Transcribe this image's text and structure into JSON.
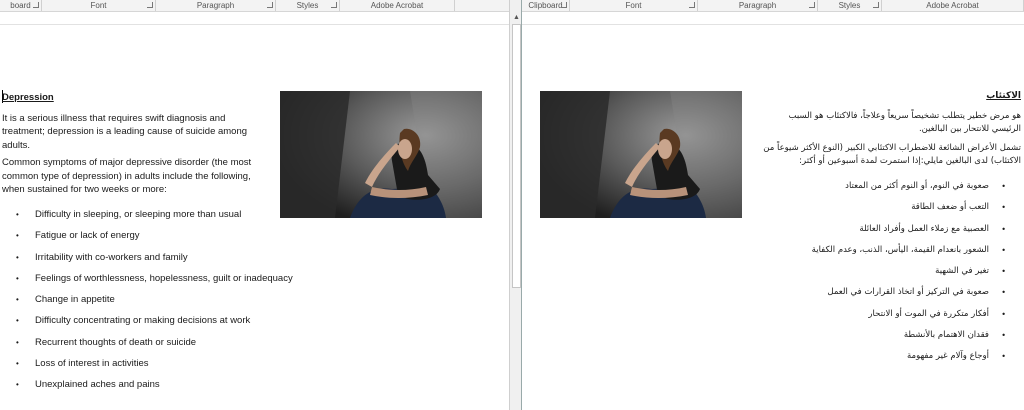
{
  "left_ribbon": {
    "groups": [
      "board",
      "Font",
      "Paragraph",
      "Styles",
      "Adobe Acrobat"
    ]
  },
  "right_ribbon": {
    "groups": [
      "Clipboard",
      "Font",
      "Paragraph",
      "Styles",
      "Adobe Acrobat"
    ]
  },
  "left_doc": {
    "heading": "Depression",
    "p1": "It is a serious illness that requires swift diagnosis and treatment; depression is a leading cause of suicide among adults.",
    "p2": "Common symptoms of major depressive disorder (the most common type of depression) in adults include the following, when sustained for two weeks or more:",
    "bullets": [
      "Difficulty in sleeping, or sleeping more than usual",
      "Fatigue or lack of energy",
      "Irritability with co-workers and family",
      "Feelings of worthlessness, hopelessness, guilt or inadequacy",
      "Change in appetite",
      "Difficulty concentrating or making decisions at work",
      "Recurrent thoughts of death or suicide",
      "Loss of interest in activities",
      "Unexplained aches and pains"
    ]
  },
  "right_doc": {
    "heading": "الاكتئاب",
    "p1": "هو مرض خطير يتطلب تشخيصاً سريعاً وعلاجاً، فالاكتئاب هو السبب الرئيسي للانتحار بين البالغين.",
    "p2": "تشمل الأعراض الشائعة للاضطراب الاكتئابي الكبير (النوع الأكثر شيوعاً من الاكتئاب) لدى البالغين مايلي:إذا استمرت لمدة أسبوعين أو أكثر:",
    "bullets": [
      "صعوبة في النوم، أو النوم أكثر من المعتاد",
      "التعب أو ضعف الطاقة",
      "العصبية مع زملاء العمل وأفراد العائلة",
      "الشعور بانعدام القيمة، اليأس، الذنب، وعدم الكفاية",
      "تغير في الشهية",
      "صعوبة في التركيز أو اتخاذ القرارات في العمل",
      "أفكار متكررة في الموت أو الانتحار",
      "فقدان الاهتمام بالأنشطة",
      "أوجاع وآلام غير مفهومة"
    ]
  },
  "icons": {
    "bullet": "•",
    "image": "woman-sitting-photo"
  },
  "colors": {
    "ribbon_bg": "#f3f3f3",
    "scrollbar_bg": "#f0f0f0",
    "text": "#1a1a1a"
  }
}
